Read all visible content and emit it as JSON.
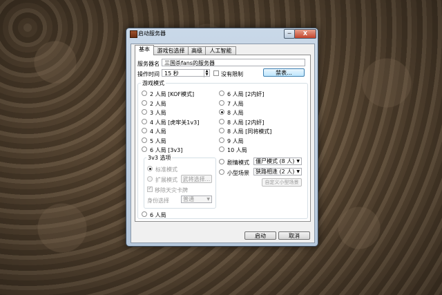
{
  "window": {
    "title": "启动服务器",
    "min_glyph": "─",
    "close_glyph": "X"
  },
  "tabs": [
    {
      "label": "基本"
    },
    {
      "label": "游戏包选择"
    },
    {
      "label": "高级"
    },
    {
      "label": "人工智能"
    }
  ],
  "basic": {
    "server_name_label": "服务器名",
    "server_name_value": "三国杀fans的服务器",
    "timeout_label": "操作时间",
    "timeout_value": "15 秒",
    "no_limit_label": "没有限制",
    "ban_button": "禁表...",
    "game_mode_title": "游戏模式",
    "modes_left": [
      {
        "label": "2 人局 [KOF模式]",
        "checked": false
      },
      {
        "label": "2 人局",
        "checked": false
      },
      {
        "label": "3 人局",
        "checked": false
      },
      {
        "label": "4 人局 [虎牢关1v3]",
        "checked": false
      },
      {
        "label": "4 人局",
        "checked": false
      },
      {
        "label": "5 人局",
        "checked": false
      },
      {
        "label": "6 人局 [3v3]",
        "checked": false
      }
    ],
    "modes_right": [
      {
        "label": "6 人局 [2内奸]",
        "checked": false
      },
      {
        "label": "7 人局",
        "checked": false
      },
      {
        "label": "8 人局",
        "checked": true
      },
      {
        "label": "8 人局 [2内奸]",
        "checked": false
      },
      {
        "label": "8 人局 [同将模式]",
        "checked": false
      },
      {
        "label": "9 人局",
        "checked": false
      },
      {
        "label": "10 人局",
        "checked": false
      }
    ],
    "scenario_label": "剧情模式",
    "scenario_value": "僵尸模式 (8 人)",
    "mini_label": "小型场景",
    "mini_value": "狭路相逢 (2 人)",
    "custom_mini_button": "自定义小型场景",
    "v3_group_title": "3v3 选项",
    "v3_standard": "标准模式",
    "v3_extended": "扩展模式",
    "v3_select_generals": "武将选择...",
    "v3_exclude": "移除天灾卡牌",
    "v3_role_label": "身份选择",
    "v3_role_value": "普通",
    "six_player": "6 人局"
  },
  "footer": {
    "start_button": "启动",
    "cancel_button": "取消"
  },
  "colors": {
    "title_bar": "#c9d8e8",
    "close_button": "#c2442c",
    "desktop": "#5b4a37"
  }
}
